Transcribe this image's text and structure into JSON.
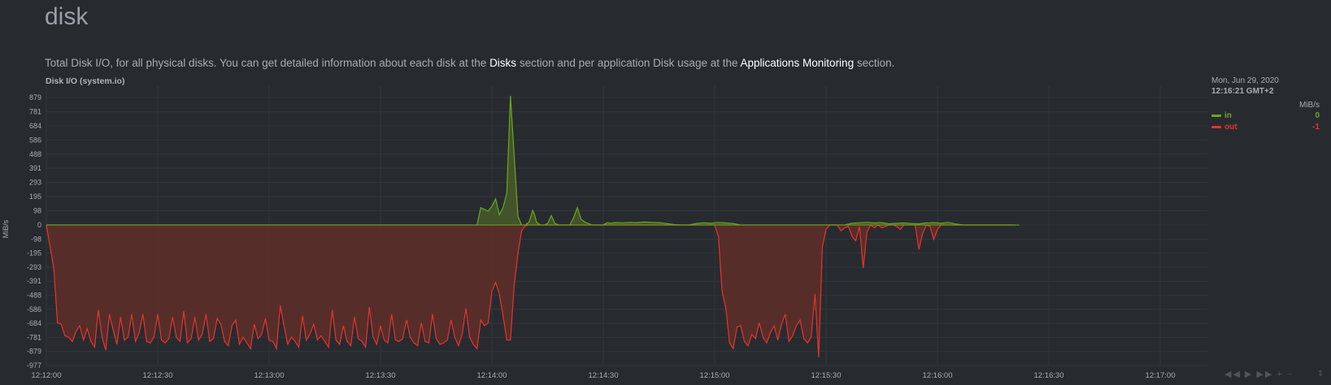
{
  "section": {
    "title": "disk",
    "desc_part1": "Total Disk I/O, for all physical disks. You can get detailed information about each disk at the ",
    "link_disks": "Disks",
    "desc_part2": " section and per application Disk usage at the ",
    "link_apps": "Applications Monitoring",
    "desc_part3": " section."
  },
  "chart": {
    "title": "Disk I/O (system.io)",
    "units_axis": "MiB/s"
  },
  "legend": {
    "date": "Mon, Jun 29, 2020",
    "time": "12:16:21 GMT+2",
    "units": "MiB/s",
    "series": [
      {
        "name": "in",
        "value": "0",
        "color": "#6aa91c"
      },
      {
        "name": "out",
        "value": "-1",
        "color": "#e8342a"
      }
    ]
  },
  "colors": {
    "background": "#272b30",
    "grid": "#32373c",
    "in_fill": "#44552a",
    "out_fill": "#5a2d2a"
  },
  "icons": [
    "rewind-icon",
    "play-icon",
    "fast-forward-icon",
    "zoom-in-icon",
    "zoom-out-icon",
    "resize-icon"
  ],
  "chart_data": {
    "type": "area",
    "title": "Disk I/O (system.io)",
    "ylabel": "MiB/s",
    "y_ticks": [
      879,
      781,
      684,
      586,
      488,
      391,
      293,
      195,
      98,
      0,
      -98,
      -195,
      -293,
      -391,
      -488,
      -586,
      -684,
      -781,
      -879,
      -977
    ],
    "ylim": [
      -977,
      950
    ],
    "x_ticks": [
      "12:12:00",
      "12:12:30",
      "12:13:00",
      "12:13:30",
      "12:14:00",
      "12:14:30",
      "12:15:00",
      "12:15:30",
      "12:16:00",
      "12:16:30",
      "12:17:00"
    ],
    "x_tick_seconds": [
      0,
      30,
      60,
      90,
      120,
      150,
      180,
      210,
      240,
      270,
      300
    ],
    "x_range_seconds": [
      0,
      312
    ],
    "grid": true,
    "series": [
      {
        "name": "in",
        "x": [
          0,
          116,
          117,
          119,
          120,
          121,
          122,
          123,
          124,
          125,
          127,
          128,
          129,
          130,
          131,
          131.5,
          132,
          133,
          134,
          135,
          136,
          137,
          138,
          139,
          140,
          141,
          142,
          143,
          144,
          145,
          146,
          147,
          148,
          149,
          150,
          151,
          152,
          153,
          155,
          157,
          159,
          161,
          163,
          165,
          167,
          169,
          171,
          173,
          175,
          177,
          179,
          181,
          183,
          185,
          187,
          189,
          191,
          193,
          195,
          197,
          199,
          201,
          203,
          205,
          207,
          209,
          211,
          213,
          215,
          217,
          219,
          221,
          223,
          225,
          227,
          229,
          231,
          233,
          235,
          237,
          239,
          241,
          243,
          245,
          247,
          249,
          251,
          253,
          255,
          257,
          259,
          261
        ],
        "y": [
          0,
          0,
          120,
          95,
          130,
          180,
          70,
          120,
          220,
          890,
          60,
          0,
          0,
          20,
          100,
          70,
          20,
          0,
          0,
          10,
          65,
          10,
          0,
          0,
          0,
          0,
          50,
          120,
          40,
          20,
          10,
          0,
          0,
          0,
          0,
          15,
          12,
          16,
          15,
          18,
          16,
          20,
          18,
          16,
          10,
          3,
          0,
          0,
          10,
          15,
          12,
          18,
          14,
          10,
          0,
          0,
          0,
          0,
          0,
          0,
          0,
          0,
          0,
          0,
          0,
          0,
          0,
          0,
          0,
          12,
          15,
          18,
          14,
          16,
          8,
          12,
          14,
          10,
          8,
          14,
          16,
          12,
          18,
          6,
          0,
          0,
          0,
          0,
          0,
          0,
          0,
          0
        ]
      },
      {
        "name": "out",
        "x": [
          0,
          2,
          3,
          4,
          5,
          6,
          7,
          8,
          9,
          10,
          11,
          12,
          13,
          14,
          15,
          16,
          17,
          18,
          19,
          20,
          21,
          22,
          23,
          24,
          25,
          26,
          27,
          28,
          29,
          30,
          31,
          32,
          33,
          34,
          35,
          36,
          37,
          38,
          39,
          40,
          41,
          42,
          43,
          44,
          45,
          46,
          47,
          48,
          49,
          50,
          51,
          52,
          53,
          54,
          55,
          56,
          57,
          58,
          59,
          60,
          61,
          62,
          63,
          64,
          65,
          66,
          67,
          68,
          69,
          70,
          71,
          72,
          73,
          74,
          75,
          76,
          77,
          78,
          79,
          80,
          81,
          82,
          83,
          84,
          85,
          86,
          87,
          88,
          89,
          90,
          91,
          92,
          93,
          94,
          95,
          96,
          97,
          98,
          99,
          100,
          101,
          102,
          103,
          104,
          105,
          106,
          107,
          108,
          109,
          110,
          111,
          112,
          113,
          114,
          115,
          116,
          117,
          118,
          119,
          120,
          121,
          122,
          123,
          124,
          125,
          126,
          127,
          128,
          129,
          130,
          178,
          180,
          181,
          182,
          183,
          184,
          185,
          186,
          187,
          188,
          189,
          190,
          191,
          192,
          193,
          194,
          195,
          196,
          197,
          198,
          199,
          200,
          201,
          202,
          203,
          204,
          205,
          206,
          207,
          208,
          209,
          210,
          211,
          212,
          213,
          214,
          215,
          216,
          217,
          218,
          219,
          220,
          221,
          222,
          223,
          224,
          225,
          226,
          227,
          228,
          229,
          230,
          231,
          232,
          233,
          234,
          235,
          236,
          237,
          238,
          239,
          240,
          241,
          242,
          243,
          244,
          245,
          246,
          247,
          248,
          249,
          250,
          251,
          252,
          253,
          254,
          255,
          257,
          260
        ],
        "y": [
          0,
          -300,
          -680,
          -690,
          -770,
          -780,
          -810,
          -740,
          -700,
          -800,
          -720,
          -810,
          -850,
          -590,
          -780,
          -870,
          -620,
          -730,
          -830,
          -640,
          -800,
          -780,
          -620,
          -810,
          -750,
          -620,
          -810,
          -820,
          -780,
          -620,
          -800,
          -820,
          -790,
          -640,
          -780,
          -810,
          -600,
          -820,
          -790,
          -640,
          -800,
          -760,
          -620,
          -810,
          -790,
          -650,
          -690,
          -810,
          -840,
          -700,
          -660,
          -830,
          -780,
          -820,
          -860,
          -690,
          -790,
          -760,
          -650,
          -800,
          -810,
          -860,
          -560,
          -700,
          -830,
          -780,
          -810,
          -850,
          -630,
          -800,
          -760,
          -690,
          -800,
          -770,
          -810,
          -850,
          -590,
          -800,
          -830,
          -700,
          -810,
          -840,
          -640,
          -790,
          -810,
          -850,
          -570,
          -780,
          -830,
          -700,
          -800,
          -820,
          -620,
          -800,
          -810,
          -790,
          -660,
          -780,
          -820,
          -840,
          -680,
          -810,
          -820,
          -620,
          -790,
          -830,
          -820,
          -800,
          -660,
          -780,
          -840,
          -760,
          -580,
          -780,
          -830,
          -860,
          -660,
          -700,
          -680,
          -460,
          -400,
          -480,
          -630,
          -800,
          -800,
          -420,
          -200,
          -40,
          -5,
          0,
          0,
          0,
          -80,
          -460,
          -580,
          -820,
          -860,
          -710,
          -700,
          -810,
          -840,
          -760,
          -790,
          -680,
          -780,
          -820,
          -750,
          -700,
          -800,
          -690,
          -620,
          -810,
          -770,
          -700,
          -660,
          -790,
          -820,
          -780,
          -480,
          -920,
          -150,
          -30,
          0,
          0,
          0,
          -40,
          -20,
          -10,
          -80,
          -110,
          -10,
          -300,
          -50,
          0,
          -20,
          0,
          -20,
          -10,
          0,
          0,
          -10,
          -30,
          0,
          0,
          0,
          0,
          -170,
          -60,
          0,
          -10,
          -100,
          -30,
          0,
          0,
          0,
          0,
          0,
          0,
          0,
          0,
          0,
          0,
          0,
          0,
          0,
          0,
          0,
          0,
          0
        ]
      }
    ]
  }
}
